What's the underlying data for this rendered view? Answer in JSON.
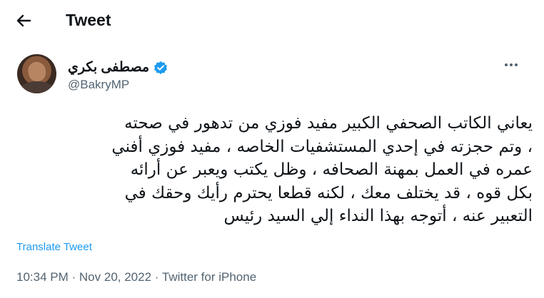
{
  "header": {
    "title": "Tweet"
  },
  "author": {
    "display_name": "مصطفى بكري",
    "handle": "@BakryMP",
    "verified": true
  },
  "tweet": {
    "lines": [
      "يعاني الكاتب الصحفي الكبير مفيد فوزي من تدهور في صحته",
      "، وتم حجزته في إحدي المستشفيات الخاصه ، مفيد فوزي أفني",
      "عمره في العمل بمهنة الصحافه ، وظل يكتب ويعبر عن أرائه",
      "بكل قوه ، قد يختلف معك ، لكنه قطعا يحترم رأيك وحقك في",
      "التعبير عنه ، أتوجه بهذا النداء إلي السيد رئيس"
    ],
    "translate_label": "Translate Tweet"
  },
  "meta": {
    "time": "10:34 PM",
    "separator": "·",
    "date": "Nov 20, 2022",
    "source": "Twitter for iPhone"
  },
  "colors": {
    "accent": "#1d9bf0",
    "secondary_text": "#536471",
    "primary_text": "#0f1419"
  }
}
